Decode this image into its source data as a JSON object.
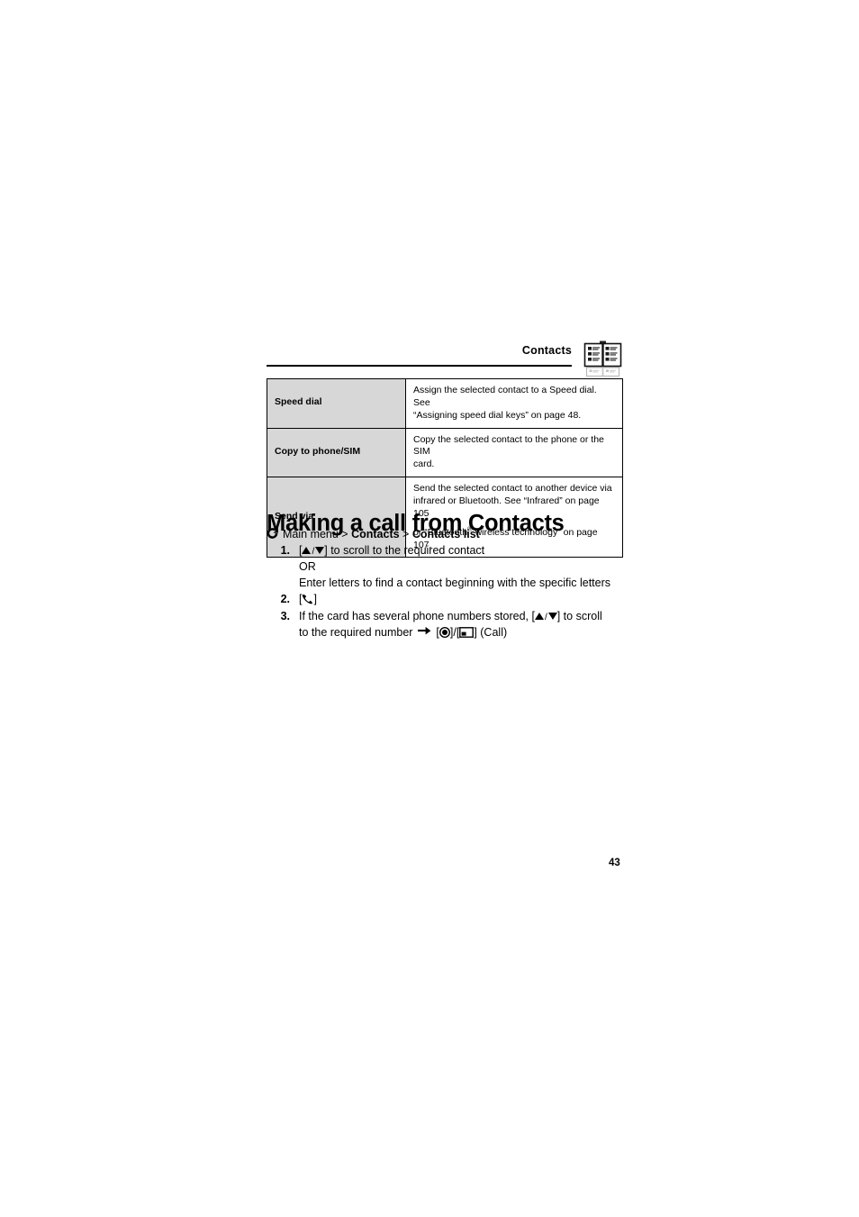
{
  "document": {
    "running_header": "Contacts",
    "header_icon": "contacts-book-icon",
    "page_number": "43"
  },
  "options_table": {
    "rows": [
      {
        "label": "Speed dial",
        "description_line1": "Assign the selected contact to a Speed dial. See",
        "description_line2": "“Assigning speed dial keys” on page 48.",
        "description_line3": ""
      },
      {
        "label": "Copy to phone/SIM",
        "description_line1": "Copy the selected contact to the phone or the SIM",
        "description_line2": "card.",
        "description_line3": ""
      },
      {
        "label": "Send via",
        "description_line1": "Send the selected contact to another device via",
        "description_line2": "infrared or Bluetooth. See “Infrared” on page 105",
        "description_line3_pre": "or “Bluetooth",
        "description_line3_sup": "®",
        "description_line3_post": " wireless technology” on page 107."
      }
    ]
  },
  "section": {
    "heading": "Making a call from Contacts",
    "nav_path": {
      "icon": "circular-arrow-icon",
      "part1": "Main menu > ",
      "part2_bold": "Contacts",
      "part3": " > ",
      "part4_bold": "Contacts list"
    },
    "steps": [
      {
        "number": "1.",
        "line1_pre": "[",
        "line1_keys": "up-down-navigation-keys",
        "line1_post": "] to scroll to the required contact",
        "line2": "OR",
        "line3": "Enter letters to find a contact beginning with the specific letters"
      },
      {
        "number": "2.",
        "line1_pre": "[",
        "line1_keys": "call-handset-key",
        "line1_post": "]"
      },
      {
        "number": "3.",
        "line1_pre": "If the card has several phone numbers stored, [",
        "line1_keys": "up-down-navigation-keys",
        "line1_post": "] to scroll",
        "line2_pre": "to the required number ",
        "line2_arrow": "right-arrow",
        "line2_mid": " [",
        "line2_key_center": "center-select-key",
        "line2_sep": "]/[",
        "line2_key_soft": "left-soft-key",
        "line2_post": "] (Call)"
      }
    ]
  },
  "colors": {
    "label_cell_background": "#d7d7d7",
    "border": "#000000",
    "text": "#000000",
    "page_background": "#ffffff"
  }
}
